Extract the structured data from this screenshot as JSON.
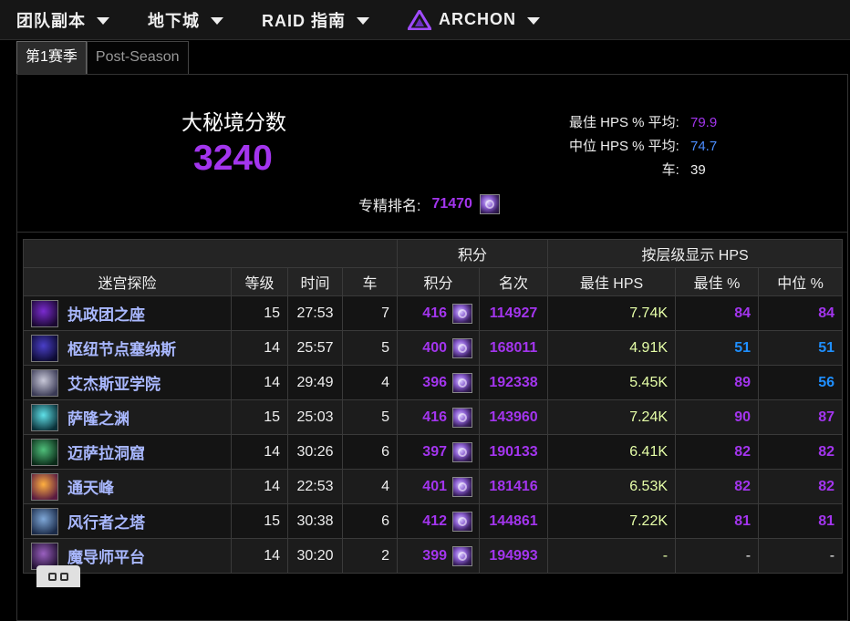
{
  "nav": {
    "items": [
      {
        "label": "团队副本"
      },
      {
        "label": "地下城"
      },
      {
        "label": "RAID 指南"
      },
      {
        "label": "ARCHON"
      }
    ]
  },
  "tabs": [
    {
      "label": "第1赛季",
      "active": true
    },
    {
      "label": "Post-Season",
      "active": false
    }
  ],
  "summary": {
    "score_title": "大秘境分数",
    "score_value": "3240",
    "best_hps_label": "最佳 HPS % 平均:",
    "best_hps_value": "79.9",
    "median_hps_label": "中位 HPS % 平均:",
    "median_hps_value": "74.7",
    "runs_label": "车:",
    "runs_value": "39",
    "spec_rank_label": "专精排名:",
    "spec_rank_value": "71470"
  },
  "table": {
    "group_headers": {
      "score": "积分",
      "hps_by_level": "按层级显示 HPS"
    },
    "headers": {
      "dungeon": "迷宫探险",
      "level": "等级",
      "time": "时间",
      "runs": "车",
      "score": "积分",
      "rank": "名次",
      "best_hps": "最佳 HPS",
      "best_pct": "最佳 %",
      "median_pct": "中位 %"
    },
    "rows": [
      {
        "name": "执政团之座",
        "level": "15",
        "time": "27:53",
        "runs": "7",
        "score": "416",
        "rank": "114927",
        "best_hps": "7.74K",
        "best_pct": "84",
        "median_pct": "84",
        "best_color": "purple",
        "median_color": "purple",
        "icon_colors": [
          "#7a2bd0",
          "#1a0830"
        ]
      },
      {
        "name": "枢纽节点塞纳斯",
        "level": "14",
        "time": "25:57",
        "runs": "5",
        "score": "400",
        "rank": "168011",
        "best_hps": "4.91K",
        "best_pct": "51",
        "median_pct": "51",
        "best_color": "blue",
        "median_color": "blue",
        "icon_colors": [
          "#4a3fc8",
          "#0c0a30"
        ]
      },
      {
        "name": "艾杰斯亚学院",
        "level": "14",
        "time": "29:49",
        "runs": "4",
        "score": "396",
        "rank": "192338",
        "best_hps": "5.45K",
        "best_pct": "89",
        "median_pct": "56",
        "best_color": "purple",
        "median_color": "blue",
        "icon_colors": [
          "#c8c8d8",
          "#3a3a55"
        ]
      },
      {
        "name": "萨隆之渊",
        "level": "15",
        "time": "25:03",
        "runs": "5",
        "score": "416",
        "rank": "143960",
        "best_hps": "7.24K",
        "best_pct": "90",
        "median_pct": "87",
        "best_color": "purple",
        "median_color": "purple",
        "icon_colors": [
          "#5fe0e8",
          "#0a3038"
        ]
      },
      {
        "name": "迈萨拉洞窟",
        "level": "14",
        "time": "30:26",
        "runs": "6",
        "score": "397",
        "rank": "190133",
        "best_hps": "6.41K",
        "best_pct": "82",
        "median_pct": "82",
        "best_color": "purple",
        "median_color": "purple",
        "icon_colors": [
          "#4fbf7a",
          "#0a2a18"
        ]
      },
      {
        "name": "通天峰",
        "level": "14",
        "time": "22:53",
        "runs": "4",
        "score": "401",
        "rank": "181416",
        "best_hps": "6.53K",
        "best_pct": "82",
        "median_pct": "82",
        "best_color": "purple",
        "median_color": "purple",
        "icon_colors": [
          "#ffb040",
          "#5a1a40"
        ]
      },
      {
        "name": "风行者之塔",
        "level": "15",
        "time": "30:38",
        "runs": "6",
        "score": "412",
        "rank": "144861",
        "best_hps": "7.22K",
        "best_pct": "81",
        "median_pct": "81",
        "best_color": "purple",
        "median_color": "purple",
        "icon_colors": [
          "#7fa8d8",
          "#1a2a48"
        ]
      },
      {
        "name": "魔导师平台",
        "level": "14",
        "time": "30:20",
        "runs": "2",
        "score": "399",
        "rank": "194993",
        "best_hps": "-",
        "best_pct": "-",
        "median_pct": "-",
        "best_color": "white",
        "median_color": "white",
        "icon_colors": [
          "#9a60c0",
          "#201030"
        ]
      }
    ]
  }
}
